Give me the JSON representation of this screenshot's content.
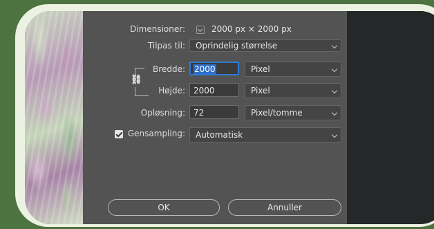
{
  "dialog": {
    "dimensions_label": "Dimensioner:",
    "dimensions_value": "2000 px  ×  2000 px",
    "fit_label": "Tilpas til:",
    "fit_value": "Oprindelig størrelse",
    "width_label": "Bredde:",
    "width_value": "2000",
    "width_unit": "Pixel",
    "height_label": "Højde:",
    "height_value": "2000",
    "height_unit": "Pixel",
    "resolution_label": "Opløsning:",
    "resolution_value": "72",
    "resolution_unit": "Pixel/tomme",
    "resample_label": "Gensampling:",
    "resample_checked": true,
    "resample_value": "Automatisk",
    "ok_label": "OK",
    "cancel_label": "Annuller",
    "link_icon": "chain-link-icon"
  },
  "colors": {
    "accent": "#2e7bd6",
    "dialog_bg": "#535353",
    "background": "#4d7440"
  }
}
